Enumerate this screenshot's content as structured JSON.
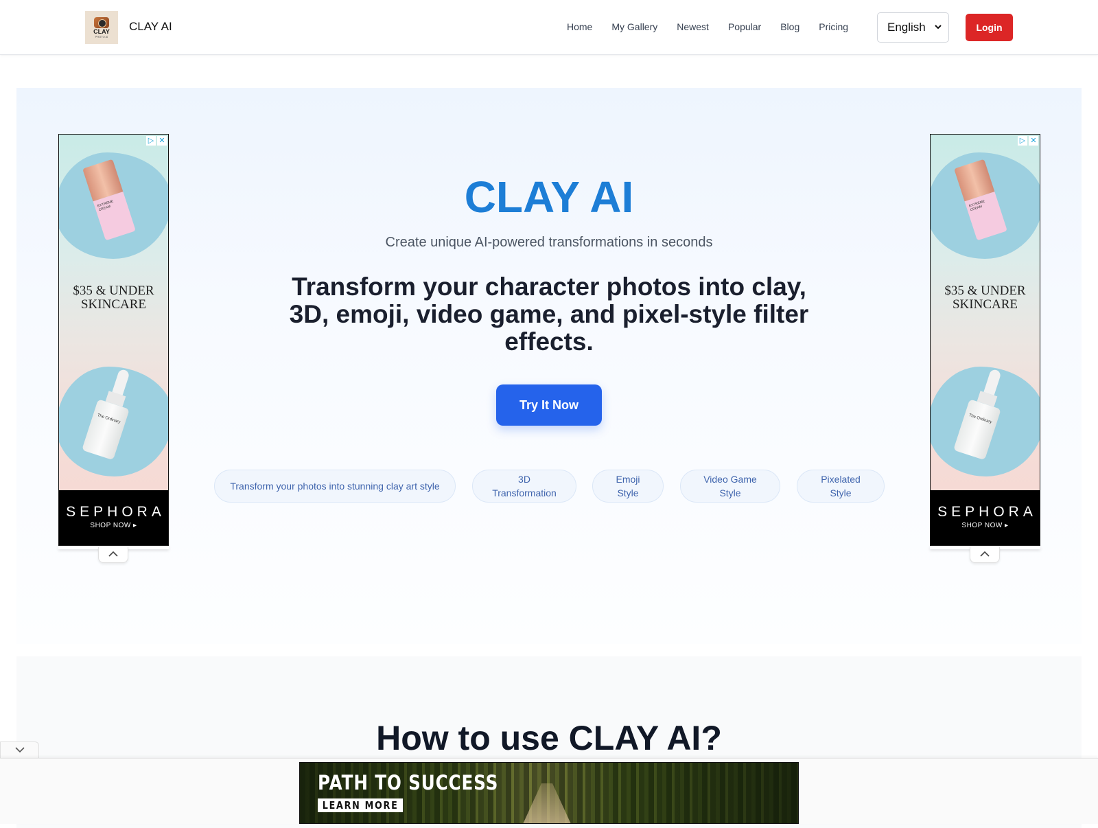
{
  "header": {
    "logo": {
      "text": "CLAY",
      "subtext": "PHOTO AI"
    },
    "brand": "CLAY AI",
    "nav": [
      {
        "label": "Home"
      },
      {
        "label": "My Gallery"
      },
      {
        "label": "Newest"
      },
      {
        "label": "Popular"
      },
      {
        "label": "Blog"
      },
      {
        "label": "Pricing"
      }
    ],
    "language": {
      "selected": "English",
      "icon": "chevron-down-icon"
    },
    "login_label": "Login",
    "login_color": "#dc2626"
  },
  "hero": {
    "title": "CLAY AI",
    "title_color": "#1d7ed6",
    "subtitle": "Create unique AI-powered transformations in seconds",
    "description": "Transform your character photos into clay, 3D, emoji, video game, and pixel-style filter effects.",
    "cta_label": "Try It Now",
    "cta_color": "#2563eb",
    "tags": [
      {
        "label": "Transform your photos into stunning clay art style"
      },
      {
        "label": "3D Transformation"
      },
      {
        "label": "Emoji Style"
      },
      {
        "label": "Video Game Style"
      },
      {
        "label": "Pixelated Style"
      }
    ]
  },
  "side_ads": {
    "left": {
      "headline_line1": "$35 & UNDER",
      "headline_line2": "SKINCARE",
      "product1_label": "EXTREME CREAM",
      "product2_label": "The Ordinary",
      "brand": "SEPHORA",
      "cta": "SHOP NOW ▸",
      "adchoices_icon": "▷",
      "close_icon": "✕"
    },
    "right": {
      "headline_line1": "$35 & UNDER",
      "headline_line2": "SKINCARE",
      "product1_label": "EXTREME CREAM",
      "product2_label": "The Ordinary",
      "brand": "SEPHORA",
      "cta": "SHOP NOW ▸",
      "adchoices_icon": "▷",
      "close_icon": "✕"
    }
  },
  "howto": {
    "title": "How to use CLAY AI?"
  },
  "anchor_ad": {
    "title": "PATH TO SUCCESS",
    "cta": "LEARN MORE"
  }
}
